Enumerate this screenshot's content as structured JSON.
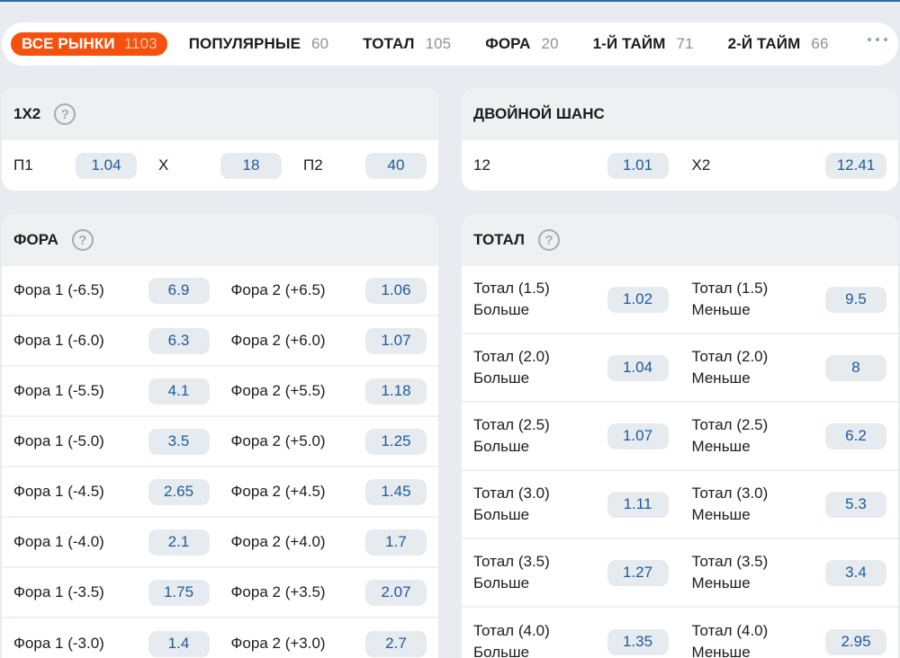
{
  "tabs": [
    {
      "label": "ВСЕ РЫНКИ",
      "count": "1103",
      "active": true
    },
    {
      "label": "ПОПУЛЯРНЫЕ",
      "count": "60"
    },
    {
      "label": "ТОТАЛ",
      "count": "105"
    },
    {
      "label": "ФОРА",
      "count": "20"
    },
    {
      "label": "1-Й ТАЙМ",
      "count": "71"
    },
    {
      "label": "2-Й ТАЙМ",
      "count": "66"
    }
  ],
  "m1x2": {
    "title": "1X2",
    "outcomes": [
      {
        "label": "П1",
        "odd": "1.04"
      },
      {
        "label": "X",
        "odd": "18"
      },
      {
        "label": "П2",
        "odd": "40"
      }
    ]
  },
  "double": {
    "title": "ДВОЙНОЙ ШАНС",
    "outcomes": [
      {
        "label": "12",
        "odd": "1.01"
      },
      {
        "label": "X2",
        "odd": "12.41"
      }
    ]
  },
  "fora": {
    "title": "ФОРА",
    "rows": [
      {
        "l1": "Фора 1 (-6.5)",
        "o1": "6.9",
        "l2": "Фора 2 (+6.5)",
        "o2": "1.06"
      },
      {
        "l1": "Фора 1 (-6.0)",
        "o1": "6.3",
        "l2": "Фора 2 (+6.0)",
        "o2": "1.07"
      },
      {
        "l1": "Фора 1 (-5.5)",
        "o1": "4.1",
        "l2": "Фора 2 (+5.5)",
        "o2": "1.18"
      },
      {
        "l1": "Фора 1 (-5.0)",
        "o1": "3.5",
        "l2": "Фора 2 (+5.0)",
        "o2": "1.25"
      },
      {
        "l1": "Фора 1 (-4.5)",
        "o1": "2.65",
        "l2": "Фора 2 (+4.5)",
        "o2": "1.45"
      },
      {
        "l1": "Фора 1 (-4.0)",
        "o1": "2.1",
        "l2": "Фора 2 (+4.0)",
        "o2": "1.7"
      },
      {
        "l1": "Фора 1 (-3.5)",
        "o1": "1.75",
        "l2": "Фора 2 (+3.5)",
        "o2": "2.07"
      },
      {
        "l1": "Фора 1 (-3.0)",
        "o1": "1.4",
        "l2": "Фора 2 (+3.0)",
        "o2": "2.7"
      }
    ]
  },
  "total": {
    "title": "ТОТАЛ",
    "rows": [
      {
        "t1": "Тотал (1.5)",
        "s1": "Больше",
        "o1": "1.02",
        "t2": "Тотал (1.5)",
        "s2": "Меньше",
        "o2": "9.5"
      },
      {
        "t1": "Тотал (2.0)",
        "s1": "Больше",
        "o1": "1.04",
        "t2": "Тотал (2.0)",
        "s2": "Меньше",
        "o2": "8"
      },
      {
        "t1": "Тотал (2.5)",
        "s1": "Больше",
        "o1": "1.07",
        "t2": "Тотал (2.5)",
        "s2": "Меньше",
        "o2": "6.2"
      },
      {
        "t1": "Тотал (3.0)",
        "s1": "Больше",
        "o1": "1.11",
        "t2": "Тотал (3.0)",
        "s2": "Меньше",
        "o2": "5.3"
      },
      {
        "t1": "Тотал (3.5)",
        "s1": "Больше",
        "o1": "1.27",
        "t2": "Тотал (3.5)",
        "s2": "Меньше",
        "o2": "3.4"
      },
      {
        "t1": "Тотал (4.0)",
        "s1": "Больше",
        "o1": "1.35",
        "t2": "Тотал (4.0)",
        "s2": "Меньше",
        "o2": "2.95"
      }
    ]
  },
  "colors": {
    "accent": "#f5500c",
    "odd_text": "#1f5a96",
    "odd_bg": "#e6ebf0"
  },
  "icons": {
    "help": "help-icon",
    "more": "more-dots-icon"
  }
}
